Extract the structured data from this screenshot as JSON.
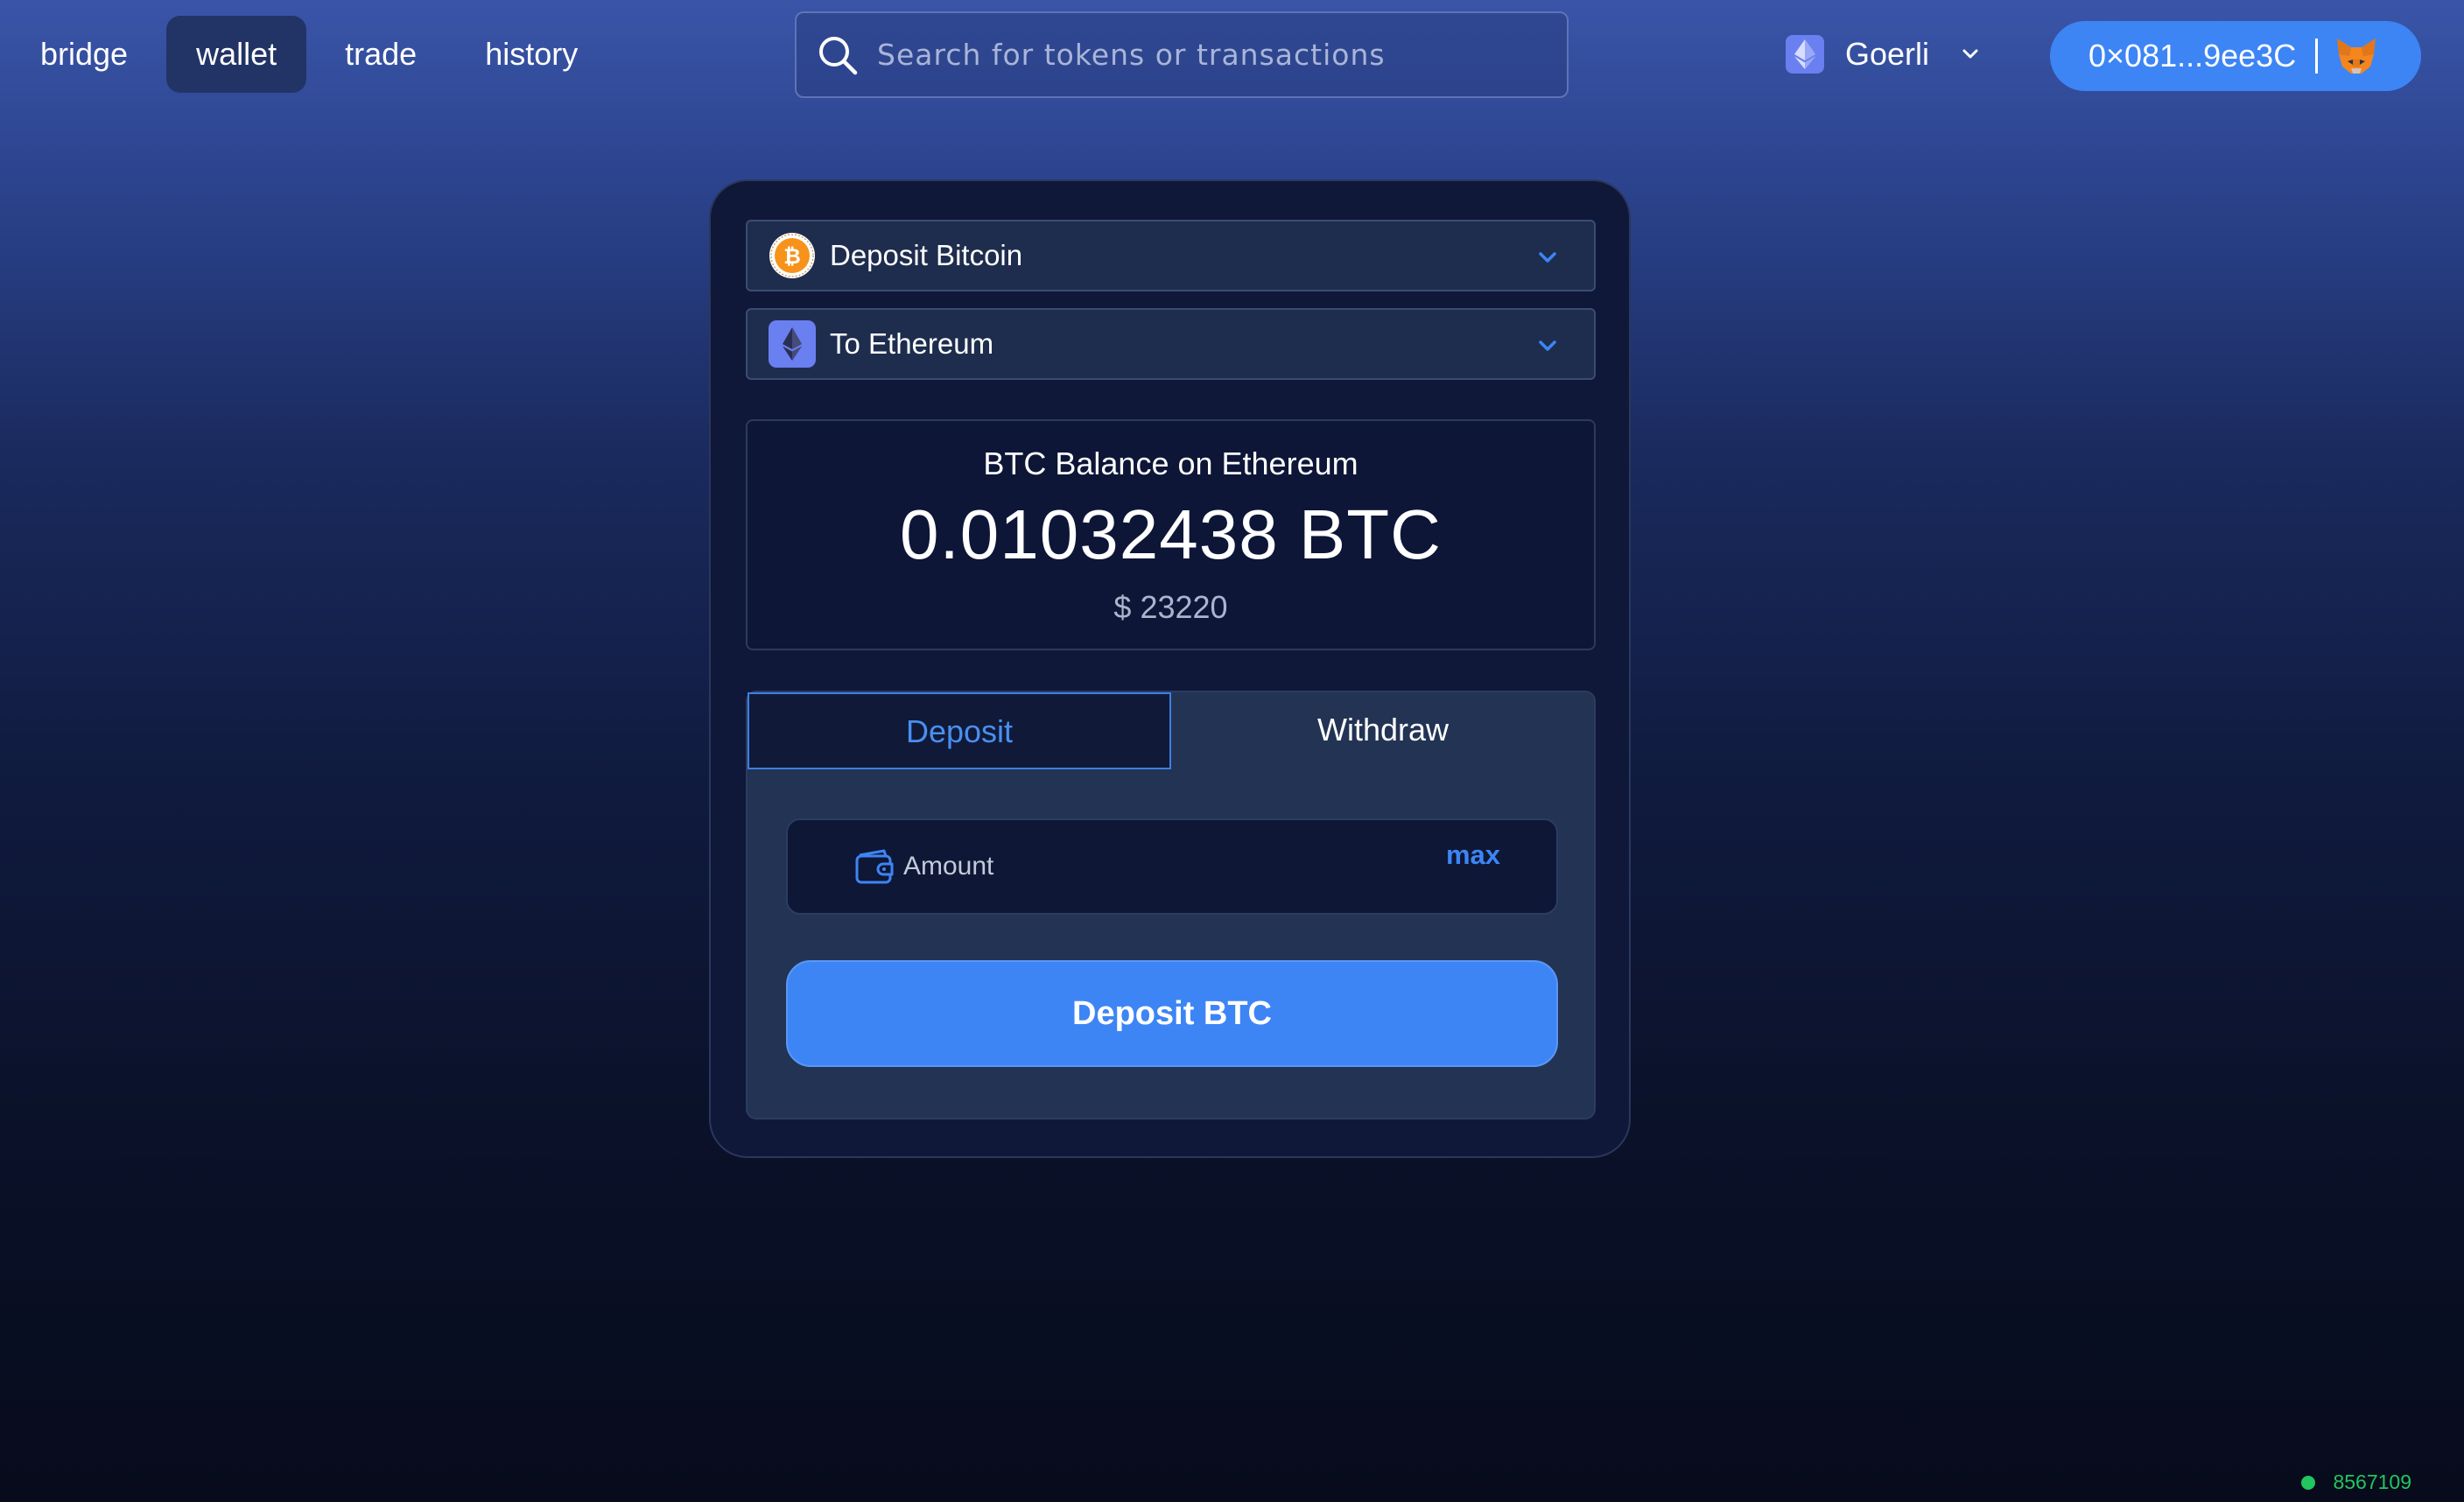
{
  "nav": {
    "items": [
      {
        "label": "bridge",
        "active": false
      },
      {
        "label": "wallet",
        "active": true
      },
      {
        "label": "trade",
        "active": false
      },
      {
        "label": "history",
        "active": false
      }
    ]
  },
  "search": {
    "placeholder": "Search for tokens or transactions",
    "icon": "search-icon"
  },
  "network": {
    "label": "Goerli",
    "icon": "ethereum-icon"
  },
  "account": {
    "address": "0×081...9ee3C",
    "wallet_icon": "metamask-fox-icon"
  },
  "card": {
    "asset_selector": {
      "label": "Deposit Bitcoin",
      "icon": "bitcoin-icon"
    },
    "chain_selector": {
      "label": "To Ethereum",
      "icon": "ethereum-icon"
    },
    "balance": {
      "title": "BTC Balance on Ethereum",
      "amount": "0.01032438 BTC",
      "usd": "$ 23220"
    },
    "tabs": [
      {
        "label": "Deposit",
        "active": true
      },
      {
        "label": "Withdraw",
        "active": false
      }
    ],
    "amount_input": {
      "placeholder": "Amount",
      "value": "",
      "max_label": "max"
    },
    "submit_label": "Deposit BTC"
  },
  "status": {
    "block_number": "8567109",
    "color": "#22c55e"
  },
  "colors": {
    "accent": "#3d85f5",
    "bitcoin": "#f7931a",
    "ethereum": "#6a7ff0"
  }
}
